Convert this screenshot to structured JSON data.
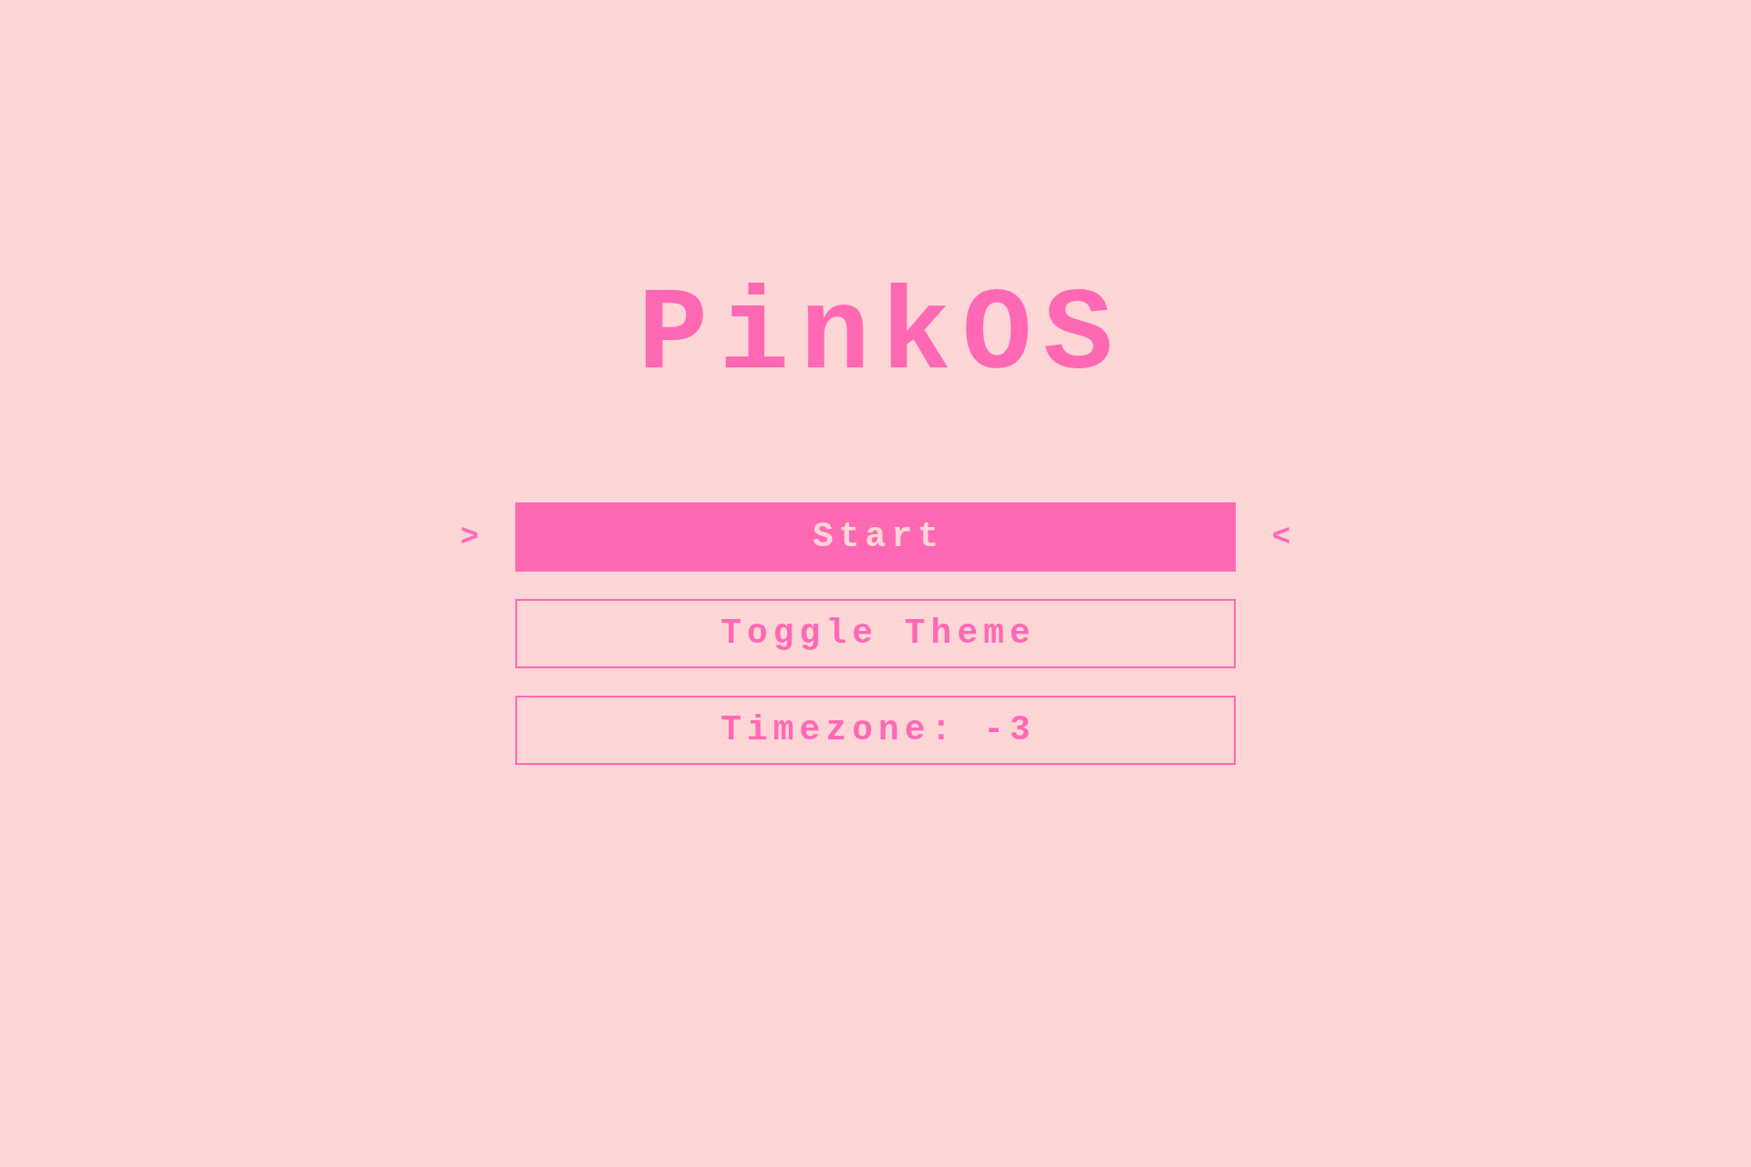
{
  "title": "PinkOS",
  "menu": {
    "cursor_left": ">",
    "cursor_right": "<",
    "items": [
      {
        "label": "Start",
        "selected": true
      },
      {
        "label": "Toggle Theme",
        "selected": false
      },
      {
        "label": "Timezone: -3",
        "selected": false
      }
    ]
  }
}
